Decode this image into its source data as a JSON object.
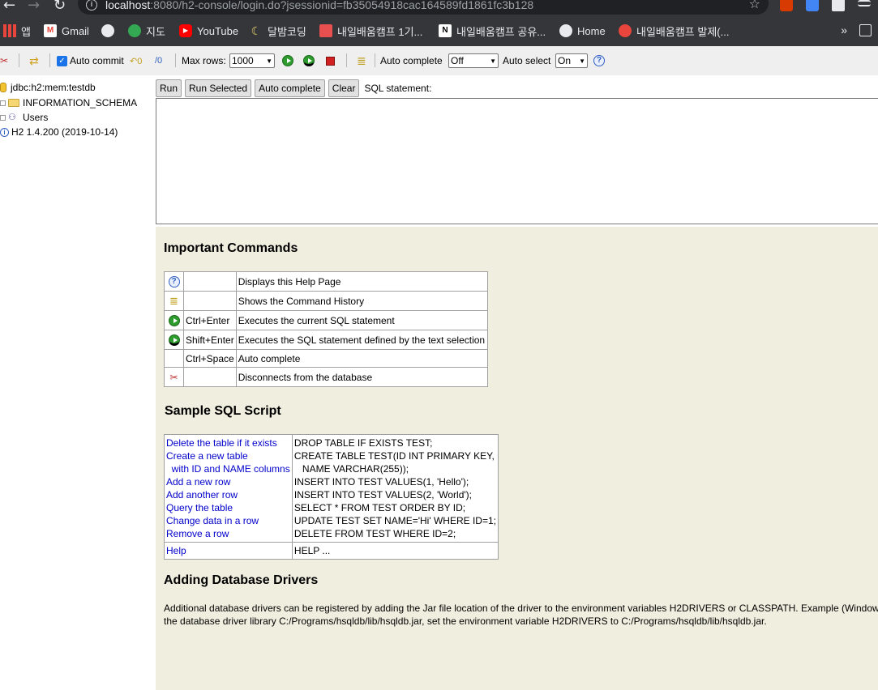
{
  "browser": {
    "url_host": "localhost",
    "url_rest": ":8080/h2-console/login.do?jsessionid=fb35054918cac164589fd1861fc3b128",
    "bookmarks": [
      {
        "label": "앱",
        "icon": "apps-grid-icon"
      },
      {
        "label": "Gmail",
        "icon": "gmail-icon"
      },
      {
        "label": "",
        "icon": "globe-icon"
      },
      {
        "label": "지도",
        "icon": "maps-pin-icon"
      },
      {
        "label": "YouTube",
        "icon": "youtube-icon"
      },
      {
        "label": "달밤코딩",
        "icon": "moon-icon"
      },
      {
        "label": "내일배움캠프 1기...",
        "icon": "bookmark-site-icon"
      },
      {
        "label": "내일배움캠프 공유...",
        "icon": "notion-icon"
      },
      {
        "label": "Home",
        "icon": "globe-icon"
      },
      {
        "label": "내일배움캠프 발제(...",
        "icon": "fire-icon"
      }
    ],
    "more": "»"
  },
  "toolbar": {
    "auto_commit_label": "Auto commit",
    "max_rows_label": "Max rows:",
    "max_rows_value": "1000",
    "auto_complete_label": "Auto complete",
    "auto_complete_value": "Off",
    "auto_select_label": "Auto select",
    "auto_select_value": "On"
  },
  "tree": {
    "connection": "jdbc:h2:mem:testdb",
    "schema": "INFORMATION_SCHEMA",
    "users": "Users",
    "version": "H2 1.4.200 (2019-10-14)"
  },
  "sql": {
    "run": "Run",
    "run_selected": "Run Selected",
    "auto_complete": "Auto complete",
    "clear": "Clear",
    "statement_label": "SQL statement:"
  },
  "help": {
    "important_title": "Important Commands",
    "commands": [
      {
        "icon": "help-icon",
        "key": "",
        "desc": "Displays this Help Page"
      },
      {
        "icon": "history-icon",
        "key": "",
        "desc": "Shows the Command History"
      },
      {
        "icon": "run-icon",
        "key": "Ctrl+Enter",
        "desc": "Executes the current SQL statement"
      },
      {
        "icon": "run-selected-icon",
        "key": "Shift+Enter",
        "desc": "Executes the SQL statement defined by the text selection"
      },
      {
        "icon": "",
        "key": "Ctrl+Space",
        "desc": "Auto complete"
      },
      {
        "icon": "disconnect-icon",
        "key": "",
        "desc": "Disconnects from the database"
      }
    ],
    "sample_title": "Sample SQL Script",
    "sample_links": [
      "Delete the table if it exists",
      "Create a new table",
      "  with ID and NAME columns",
      "Add a new row",
      "Add another row",
      "Query the table",
      "Change data in a row",
      "Remove a row"
    ],
    "sample_sql": [
      "DROP TABLE IF EXISTS TEST;",
      "CREATE TABLE TEST(ID INT PRIMARY KEY,",
      "   NAME VARCHAR(255));",
      "INSERT INTO TEST VALUES(1, 'Hello');",
      "INSERT INTO TEST VALUES(2, 'World');",
      "SELECT * FROM TEST ORDER BY ID;",
      "UPDATE TEST SET NAME='Hi' WHERE ID=1;",
      "DELETE FROM TEST WHERE ID=2;"
    ],
    "help_link": "Help",
    "help_sql": "HELP ...",
    "drivers_title": "Adding Database Drivers",
    "drivers_line1": "Additional database drivers can be registered by adding the Jar file location of the driver to the environment variables H2DRIVERS or CLASSPATH. Example (Window",
    "drivers_line2": "the database driver library C:/Programs/hsqldb/lib/hsqldb.jar, set the environment variable H2DRIVERS to C:/Programs/hsqldb/lib/hsqldb.jar."
  }
}
